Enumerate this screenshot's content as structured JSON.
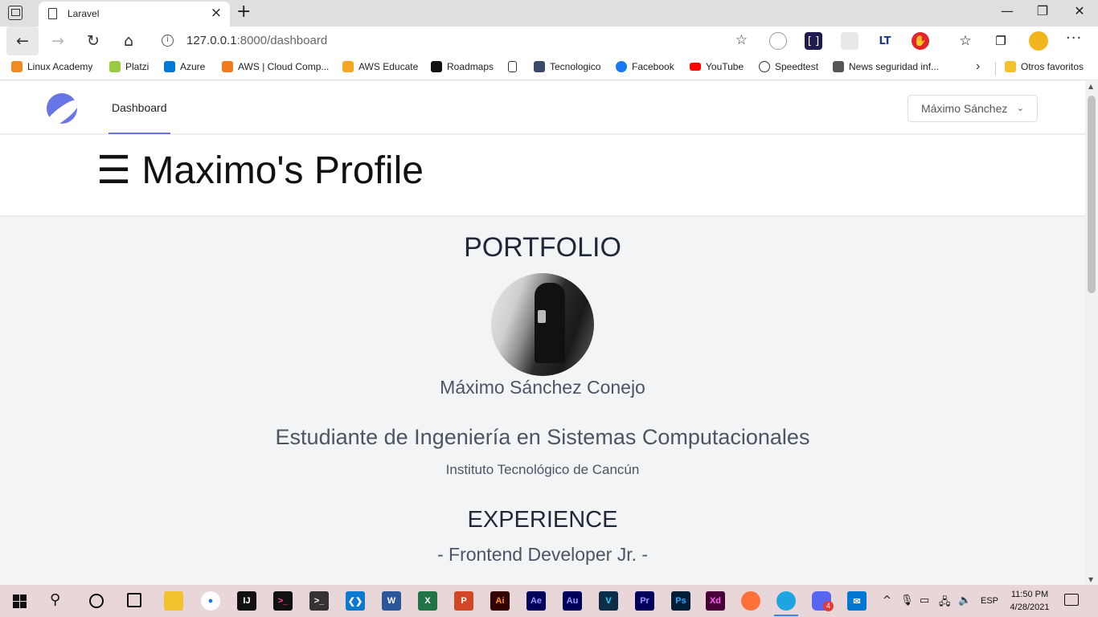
{
  "browser": {
    "tab_title": "Laravel",
    "url_host": "127.0.0.1",
    "url_path": ":8000/dashboard",
    "bookmarks": [
      {
        "label": "Linux Academy",
        "color": "#f08a24"
      },
      {
        "label": "Platzi",
        "color": "#98ca3f"
      },
      {
        "label": "Azure",
        "color": "#0078d4"
      },
      {
        "label": "AWS | Cloud Comp...",
        "color": "#f47a20"
      },
      {
        "label": "AWS Educate",
        "color": "#f5a623"
      },
      {
        "label": "Roadmaps",
        "color": "#111111"
      },
      {
        "label": "",
        "color": "#ffffff"
      },
      {
        "label": "Tecnologico",
        "color": "#3a4a6b"
      },
      {
        "label": "Facebook",
        "color": "#1877f2"
      },
      {
        "label": "YouTube",
        "color": "#ff0000"
      },
      {
        "label": "Speedtest",
        "color": "#333333"
      },
      {
        "label": "News seguridad inf...",
        "color": "#555555"
      }
    ],
    "other_favorites": "Otros favoritos"
  },
  "app": {
    "nav_link": "Dashboard",
    "user_menu": "Máximo Sánchez",
    "page_title": "☰ Maximo's Profile"
  },
  "portfolio": {
    "heading": "PORTFOLIO",
    "name": "Máximo Sánchez Conejo",
    "degree": "Estudiante de Ingeniería en Sistemas Computacionales",
    "school": "Instituto Tecnológico de Cancún",
    "experience_heading": "EXPERIENCE",
    "role": "- Frontend Developer Jr. -"
  },
  "taskbar": {
    "language": "ESP",
    "time": "11:50 PM",
    "date": "4/28/2021",
    "discord_badge": "4",
    "apps": [
      {
        "name": "file-explorer",
        "label": "",
        "color": "#f2c12e"
      },
      {
        "name": "chrome-canary",
        "label": "",
        "color": "#ffffff"
      },
      {
        "name": "intellij",
        "label": "",
        "color": "#111111"
      },
      {
        "name": "terminal-pink",
        "label": "",
        "color": "#111111"
      },
      {
        "name": "terminal",
        "label": "",
        "color": "#333333"
      },
      {
        "name": "vscode",
        "label": "",
        "color": "#0a7ad0"
      },
      {
        "name": "word",
        "label": "W",
        "color": "#2b579a"
      },
      {
        "name": "excel",
        "label": "X",
        "color": "#217346"
      },
      {
        "name": "powerpoint",
        "label": "P",
        "color": "#d24726"
      },
      {
        "name": "illustrator",
        "label": "Ai",
        "color": "#330000"
      },
      {
        "name": "after-effects",
        "label": "Ae",
        "color": "#00005b"
      },
      {
        "name": "audition",
        "label": "Au",
        "color": "#00005b"
      },
      {
        "name": "vegas",
        "label": "V",
        "color": "#0c2d48"
      },
      {
        "name": "premiere",
        "label": "Pr",
        "color": "#00005b"
      },
      {
        "name": "photoshop",
        "label": "Ps",
        "color": "#001e36"
      },
      {
        "name": "xd",
        "label": "Xd",
        "color": "#470137"
      },
      {
        "name": "firefox",
        "label": "",
        "color": "#ff7139"
      },
      {
        "name": "edge",
        "label": "",
        "color": "#1da5e2"
      },
      {
        "name": "discord",
        "label": "",
        "color": "#5865f2"
      },
      {
        "name": "mail",
        "label": "",
        "color": "#0078d4"
      }
    ]
  }
}
